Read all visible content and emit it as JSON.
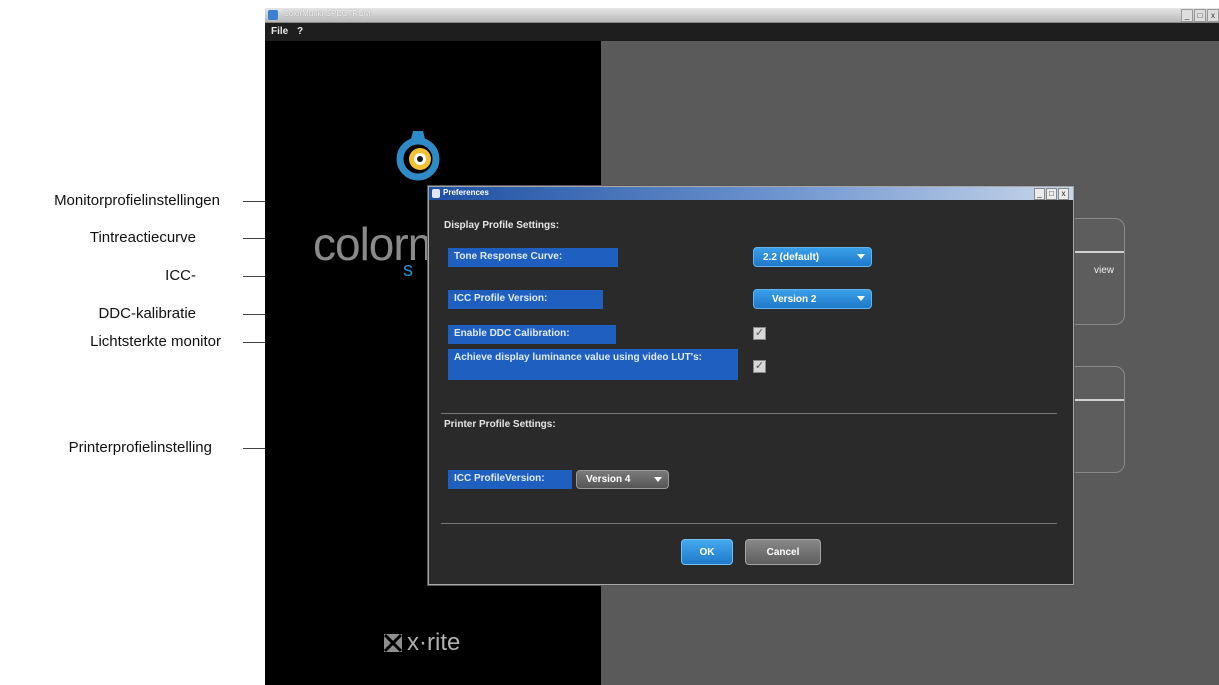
{
  "callouts": {
    "monitor_profile_settings": "Monitorprofielinstellingen",
    "tone_curve": "Tintreactiecurve",
    "icc": "ICC-",
    "ddc": "DDC-kalibratie",
    "luminance": "Lichtsterkte monitor",
    "printer_profile": "Printerprofielinstelling"
  },
  "app": {
    "title": "ColorMunki SPECTRUM",
    "menu": [
      "File",
      "?"
    ],
    "logo_text": "colorm",
    "logo_sub": "s",
    "xrite": "x·rite",
    "card_text": "view",
    "window_controls": [
      "_",
      "□",
      "x"
    ]
  },
  "dialog": {
    "title": "Preferences",
    "controls": [
      "_",
      "□",
      "x"
    ],
    "display_section": "Display Profile Settings:",
    "tone_label": "Tone Response Curve:",
    "tone_value": "2.2 (default)",
    "icc_label": "ICC Profile Version:",
    "icc_value": "Version 2",
    "ddc_label": "Enable DDC Calibration:",
    "ddc_checked": true,
    "lut_label": "Achieve display luminance value using video LUT's:",
    "lut_checked": true,
    "printer_section": "Printer Profile Settings:",
    "printer_icc_label": "ICC ProfileVersion:",
    "printer_icc_value": "Version 4",
    "ok_label": "OK",
    "cancel_label": "Cancel"
  },
  "colors": {
    "accent_blue": "#1f5fbf",
    "dialog_bg": "#2a2a2a",
    "ok_button": "#2f8fdc"
  }
}
